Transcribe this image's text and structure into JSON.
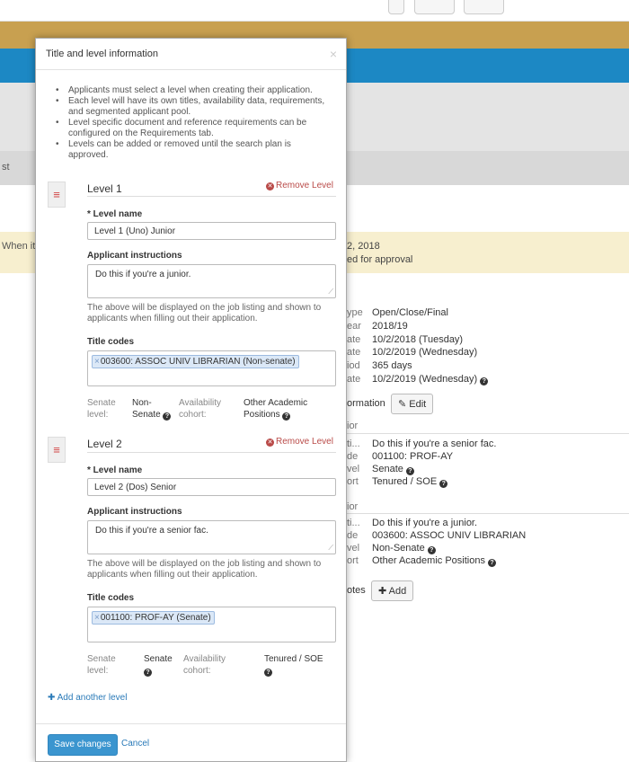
{
  "background": {
    "tab_label": "st",
    "notice_left": "When it is",
    "notice_right_line1": "2, 2018",
    "notice_right_line2": "ed for approval",
    "details": [
      {
        "key": "ype",
        "value": "Open/Close/Final"
      },
      {
        "key": "ear",
        "value": "2018/19"
      },
      {
        "key": "ate",
        "value": "10/2/2018 (Tuesday)"
      },
      {
        "key": "ate",
        "value": "10/2/2019 (Wednesday)"
      },
      {
        "key": "iod",
        "value": "365 days"
      },
      {
        "key": "ate",
        "value": "10/2/2019 (Wednesday)"
      }
    ],
    "info_label": "ormation",
    "edit_label": "Edit",
    "section_label_1": "ior",
    "level2_rows": [
      {
        "key": "ti...",
        "value": "Do this if you're a senior fac."
      },
      {
        "key": "de",
        "value": "001100: PROF-AY"
      },
      {
        "key": "vel",
        "value": "Senate"
      },
      {
        "key": "ort",
        "value": "Tenured / SOE"
      }
    ],
    "section_label_2": "ior",
    "level1_rows": [
      {
        "key": "ti...",
        "value": "Do this if you're a junior."
      },
      {
        "key": "de",
        "value": "003600: ASSOC UNIV LIBRARIAN"
      },
      {
        "key": "vel",
        "value": "Non-Senate"
      },
      {
        "key": "ort",
        "value": "Other Academic Positions"
      }
    ],
    "notes_label": "otes",
    "add_label": "Add"
  },
  "modal": {
    "title": "Title and level information",
    "close": "×",
    "bullets": [
      "Applicants must select a level when creating their application.",
      "Each level will have its own titles, availability data, requirements, and segmented applicant pool.",
      "Level specific document and reference requirements can be configured on the Requirements tab.",
      "Levels can be added or removed until the search plan is approved."
    ],
    "remove_label": "Remove Level",
    "level_name_label": "* Level name",
    "instructions_label": "Applicant instructions",
    "help_text": "The above will be displayed on the job listing and shown to applicants when filling out their application.",
    "title_codes_label": "Title codes",
    "senate_label_1": "Senate",
    "senate_label_2": "level:",
    "availability_label_1": "Availability",
    "availability_label_2": "cohort:",
    "levels": [
      {
        "heading": "Level 1",
        "name_value": "Level 1 (Uno) Junior",
        "instructions_value": "Do this if you're a junior.",
        "title_code": "003600: ASSOC UNIV LIBRARIAN (Non-senate)",
        "senate_value_1": "Non-",
        "senate_value_2": "Senate",
        "cohort_value_1": "Other Academic",
        "cohort_value_2": "Positions"
      },
      {
        "heading": "Level 2",
        "name_value": "Level 2 (Dos) Senior",
        "instructions_value": "Do this if you're a senior fac.",
        "title_code": "001100: PROF-AY (Senate)",
        "senate_value_1": "Senate",
        "senate_value_2": "",
        "cohort_value_1": "Tenured / SOE",
        "cohort_value_2": ""
      }
    ],
    "add_level_label": "Add another level",
    "save_label": "Save changes",
    "cancel_label": "Cancel"
  }
}
